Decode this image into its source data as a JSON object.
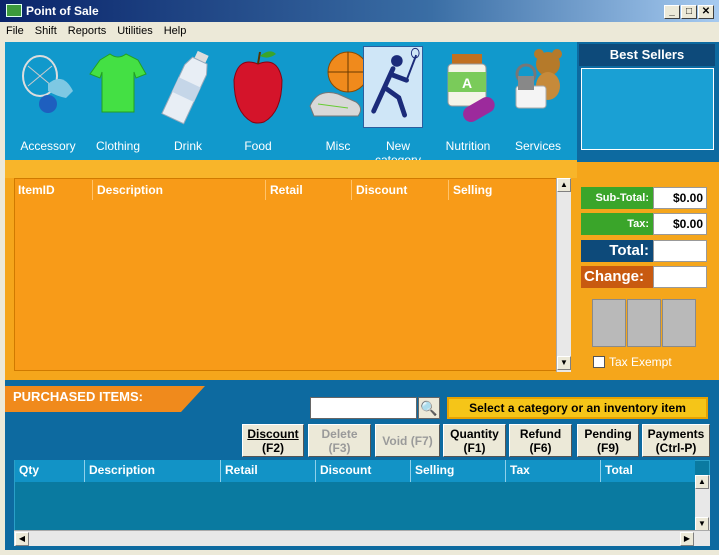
{
  "window": {
    "title": "Point of Sale",
    "min": "_",
    "max": "□",
    "close": "✕"
  },
  "menu": [
    "File",
    "Shift",
    "Reports",
    "Utilities",
    "Help"
  ],
  "categories": [
    {
      "label": "Accessory",
      "icon": "accessory-icon"
    },
    {
      "label": "Clothing",
      "icon": "shirt-icon"
    },
    {
      "label": "Drink",
      "icon": "water-bottle-icon"
    },
    {
      "label": "Food",
      "icon": "apple-icon"
    },
    {
      "label": "Misc",
      "icon": "sports-icon"
    },
    {
      "label": "New category",
      "icon": "lacrosse-player-icon"
    },
    {
      "label": "Nutrition",
      "icon": "supplement-icon"
    },
    {
      "label": "Services",
      "icon": "teddy-bear-icon"
    }
  ],
  "best_sellers": "Best Sellers",
  "items_grid": {
    "columns": [
      "ItemID",
      "Description",
      "Retail",
      "Discount",
      "Selling"
    ],
    "rows": []
  },
  "totals": {
    "subtotal_label": "Sub-Total:",
    "subtotal": "$0.00",
    "tax_label": "Tax:",
    "tax": "$0.00",
    "total_label": "Total:",
    "total": "",
    "change_label": "Change:",
    "change": ""
  },
  "tax_exempt": "Tax Exempt",
  "purchased_title": "PURCHASED ITEMS:",
  "search": {
    "value": "",
    "placeholder": ""
  },
  "hint": "Select a category or an inventory item",
  "actions": [
    {
      "label": "Discount",
      "key": "(F2)",
      "enabled": true
    },
    {
      "label": "Delete",
      "key": "(F3)",
      "enabled": false
    },
    {
      "label": "Void (F7)",
      "key": "",
      "enabled": false
    },
    {
      "label": "Quantity",
      "key": "(F1)",
      "enabled": true
    },
    {
      "label": "Refund",
      "key": "(F6)",
      "enabled": true
    },
    {
      "label": "Pending",
      "key": "(F9)",
      "enabled": true
    },
    {
      "label": "Payments",
      "key": "(Ctrl-P)",
      "enabled": true
    }
  ],
  "purchased_grid": {
    "columns": [
      "Qty",
      "Description",
      "Retail",
      "Discount",
      "Selling",
      "Tax",
      "Total"
    ],
    "rows": []
  },
  "colors": {
    "accent_orange": "#f5a61b",
    "band_blue": "#1199cc",
    "dark_blue": "#0d6aa0",
    "subtotal_green": "#3aa52a",
    "hint_yellow": "#f5c518"
  }
}
